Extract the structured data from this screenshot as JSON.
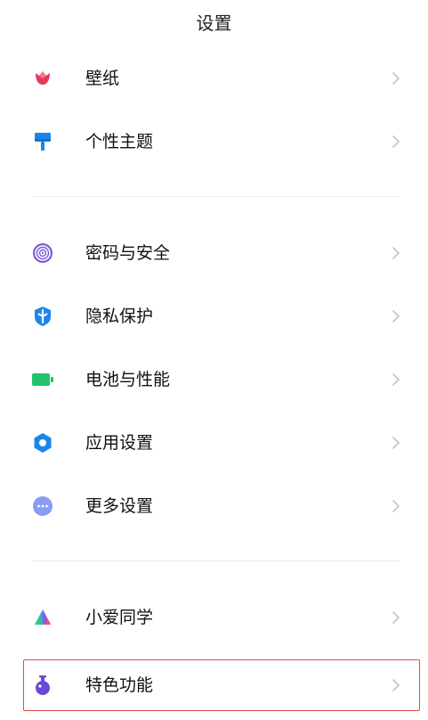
{
  "header": {
    "title": "设置"
  },
  "items": [
    {
      "label": "壁纸",
      "icon": "tulip-icon"
    },
    {
      "label": "个性主题",
      "icon": "paintbrush-icon"
    },
    {
      "label": "密码与安全",
      "icon": "fingerprint-icon"
    },
    {
      "label": "隐私保护",
      "icon": "shield-icon"
    },
    {
      "label": "电池与性能",
      "icon": "battery-icon"
    },
    {
      "label": "应用设置",
      "icon": "gear-icon"
    },
    {
      "label": "更多设置",
      "icon": "more-dots-icon"
    },
    {
      "label": "小爱同学",
      "icon": "xiaoai-assistant-icon"
    },
    {
      "label": "特色功能",
      "icon": "flask-icon"
    }
  ],
  "colors": {
    "tulip": "#e8395a",
    "brush": "#1a86ea",
    "fingerprint": "#7b57d6",
    "shield": "#1a86ea",
    "battery": "#21c36a",
    "gear": "#1a86ea",
    "more": "#8a9df2",
    "flask": "#6b49d8",
    "highlight": "#e44848"
  }
}
